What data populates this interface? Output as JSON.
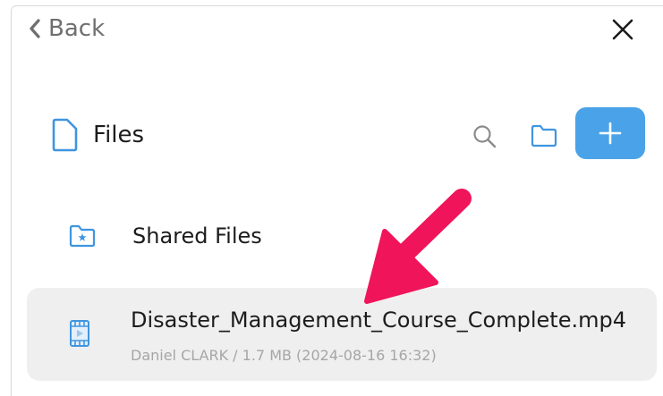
{
  "nav": {
    "back_label": "Back",
    "close_icon": "close-icon"
  },
  "files": {
    "title": "Files",
    "icons": [
      "file-icon",
      "search-icon",
      "folder-icon",
      "plus-icon"
    ],
    "accent_color": "#4aa3e8"
  },
  "list": {
    "shared": {
      "label": "Shared Files",
      "icon": "shared-folder-icon"
    },
    "file": {
      "name": "Disaster_Management_Course_Complete.mp4",
      "meta": "Daniel CLARK  /  1.7 MB (2024-08-16 16:32)",
      "icon": "video-file-icon"
    }
  },
  "annotation": {
    "arrow_color": "#f0145a",
    "icon": "pointer-arrow"
  }
}
